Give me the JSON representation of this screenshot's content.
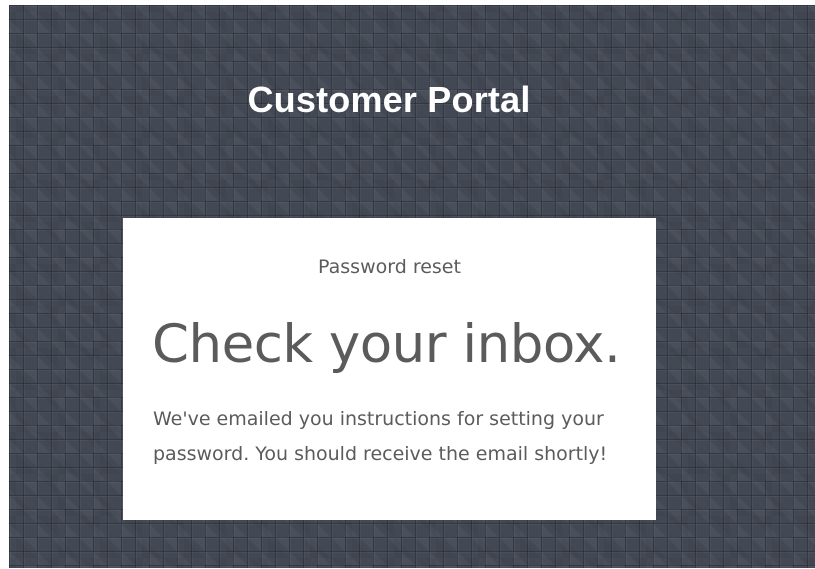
{
  "portal": {
    "title": "Customer Portal"
  },
  "card": {
    "label": "Password reset",
    "heading": "Check your inbox.",
    "message": "We've emailed you instructions for setting your password. You should receive the email shortly!"
  },
  "colors": {
    "background": "#434954",
    "card": "#ffffff",
    "text": "#5b5b5b",
    "title": "#ffffff"
  }
}
